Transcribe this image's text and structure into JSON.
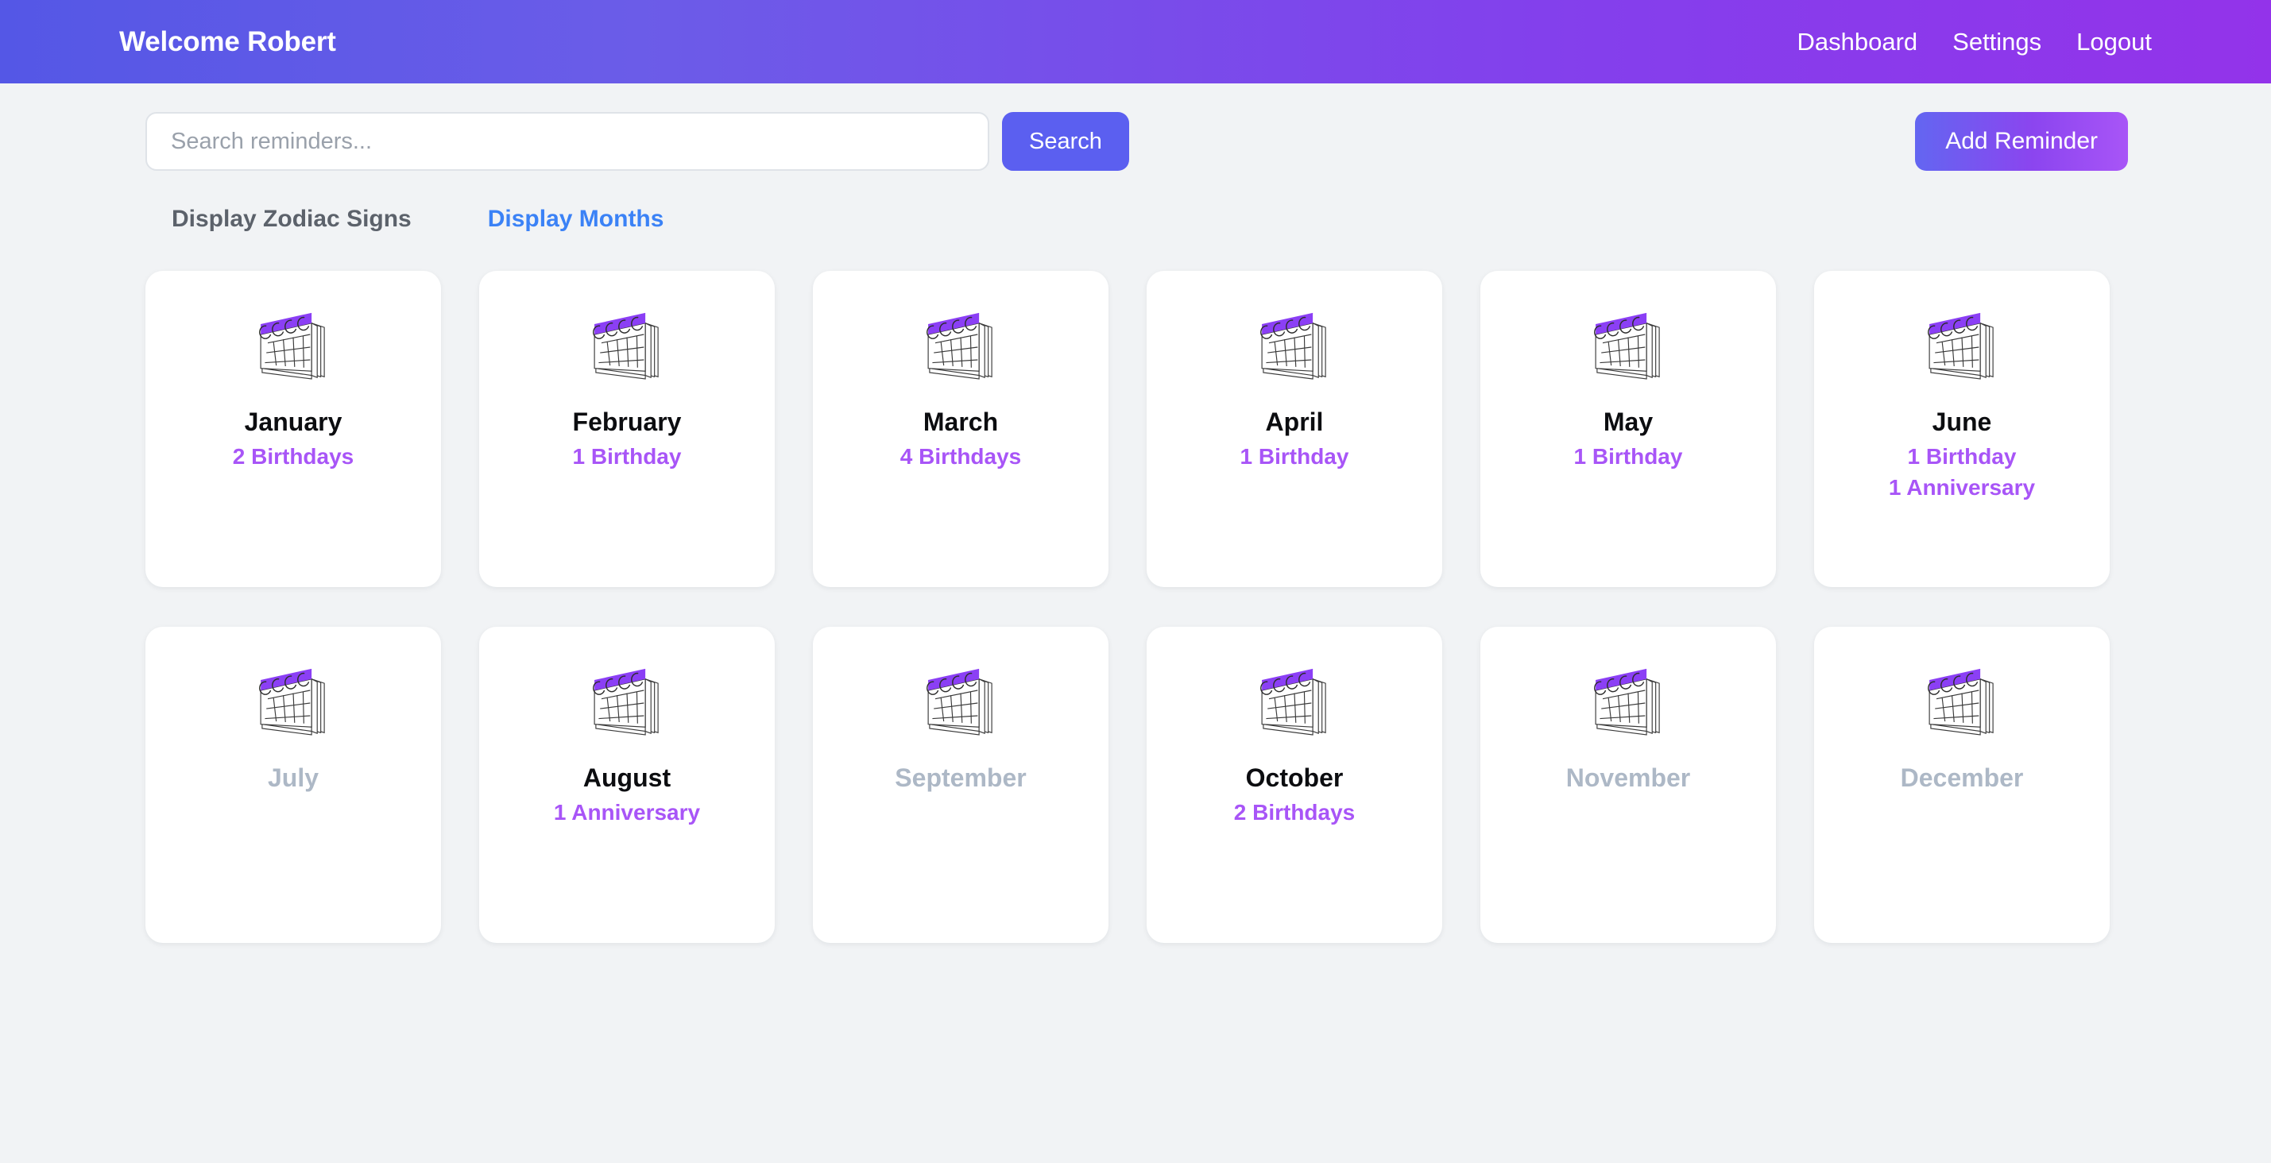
{
  "header": {
    "brand": "Welcome Robert",
    "nav": [
      {
        "label": "Dashboard",
        "name": "nav-link-dashboard"
      },
      {
        "label": "Settings",
        "name": "nav-link-settings"
      },
      {
        "label": "Logout",
        "name": "nav-link-logout"
      }
    ]
  },
  "toolbar": {
    "search_value": "",
    "search_placeholder": "Search reminders...",
    "search_button_label": "Search",
    "add_reminder_label": "Add Reminder"
  },
  "tabs": [
    {
      "label": "Display Zodiac Signs",
      "name": "tab-display-zodiac-signs",
      "active": false
    },
    {
      "label": "Display Months",
      "name": "tab-display-months",
      "active": true
    }
  ],
  "months": [
    {
      "name": "January",
      "icon": "calendar-icon",
      "counts": [
        "2 Birthdays"
      ],
      "empty": false
    },
    {
      "name": "February",
      "icon": "calendar-icon",
      "counts": [
        "1 Birthday"
      ],
      "empty": false
    },
    {
      "name": "March",
      "icon": "calendar-icon",
      "counts": [
        "4 Birthdays"
      ],
      "empty": false
    },
    {
      "name": "April",
      "icon": "calendar-icon",
      "counts": [
        "1 Birthday"
      ],
      "empty": false
    },
    {
      "name": "May",
      "icon": "calendar-icon",
      "counts": [
        "1 Birthday"
      ],
      "empty": false
    },
    {
      "name": "June",
      "icon": "calendar-icon",
      "counts": [
        "1 Birthday",
        "1 Anniversary"
      ],
      "empty": false
    },
    {
      "name": "July",
      "icon": "calendar-icon",
      "counts": [],
      "empty": true
    },
    {
      "name": "August",
      "icon": "calendar-icon",
      "counts": [
        "1 Anniversary"
      ],
      "empty": false
    },
    {
      "name": "September",
      "icon": "calendar-icon",
      "counts": [],
      "empty": true
    },
    {
      "name": "October",
      "icon": "calendar-icon",
      "counts": [
        "2 Birthdays"
      ],
      "empty": false
    },
    {
      "name": "November",
      "icon": "calendar-icon",
      "counts": [],
      "empty": true
    },
    {
      "name": "December",
      "icon": "calendar-icon",
      "counts": [],
      "empty": true
    }
  ],
  "colors": {
    "header_gradient_start": "#5457e6",
    "header_gradient_end": "#9333ea",
    "accent_purple": "#a855f7",
    "accent_blue": "#3b82f6",
    "search_button": "#5b5ff0",
    "page_background": "#f1f3f5",
    "muted_month": "#adb8c6"
  }
}
